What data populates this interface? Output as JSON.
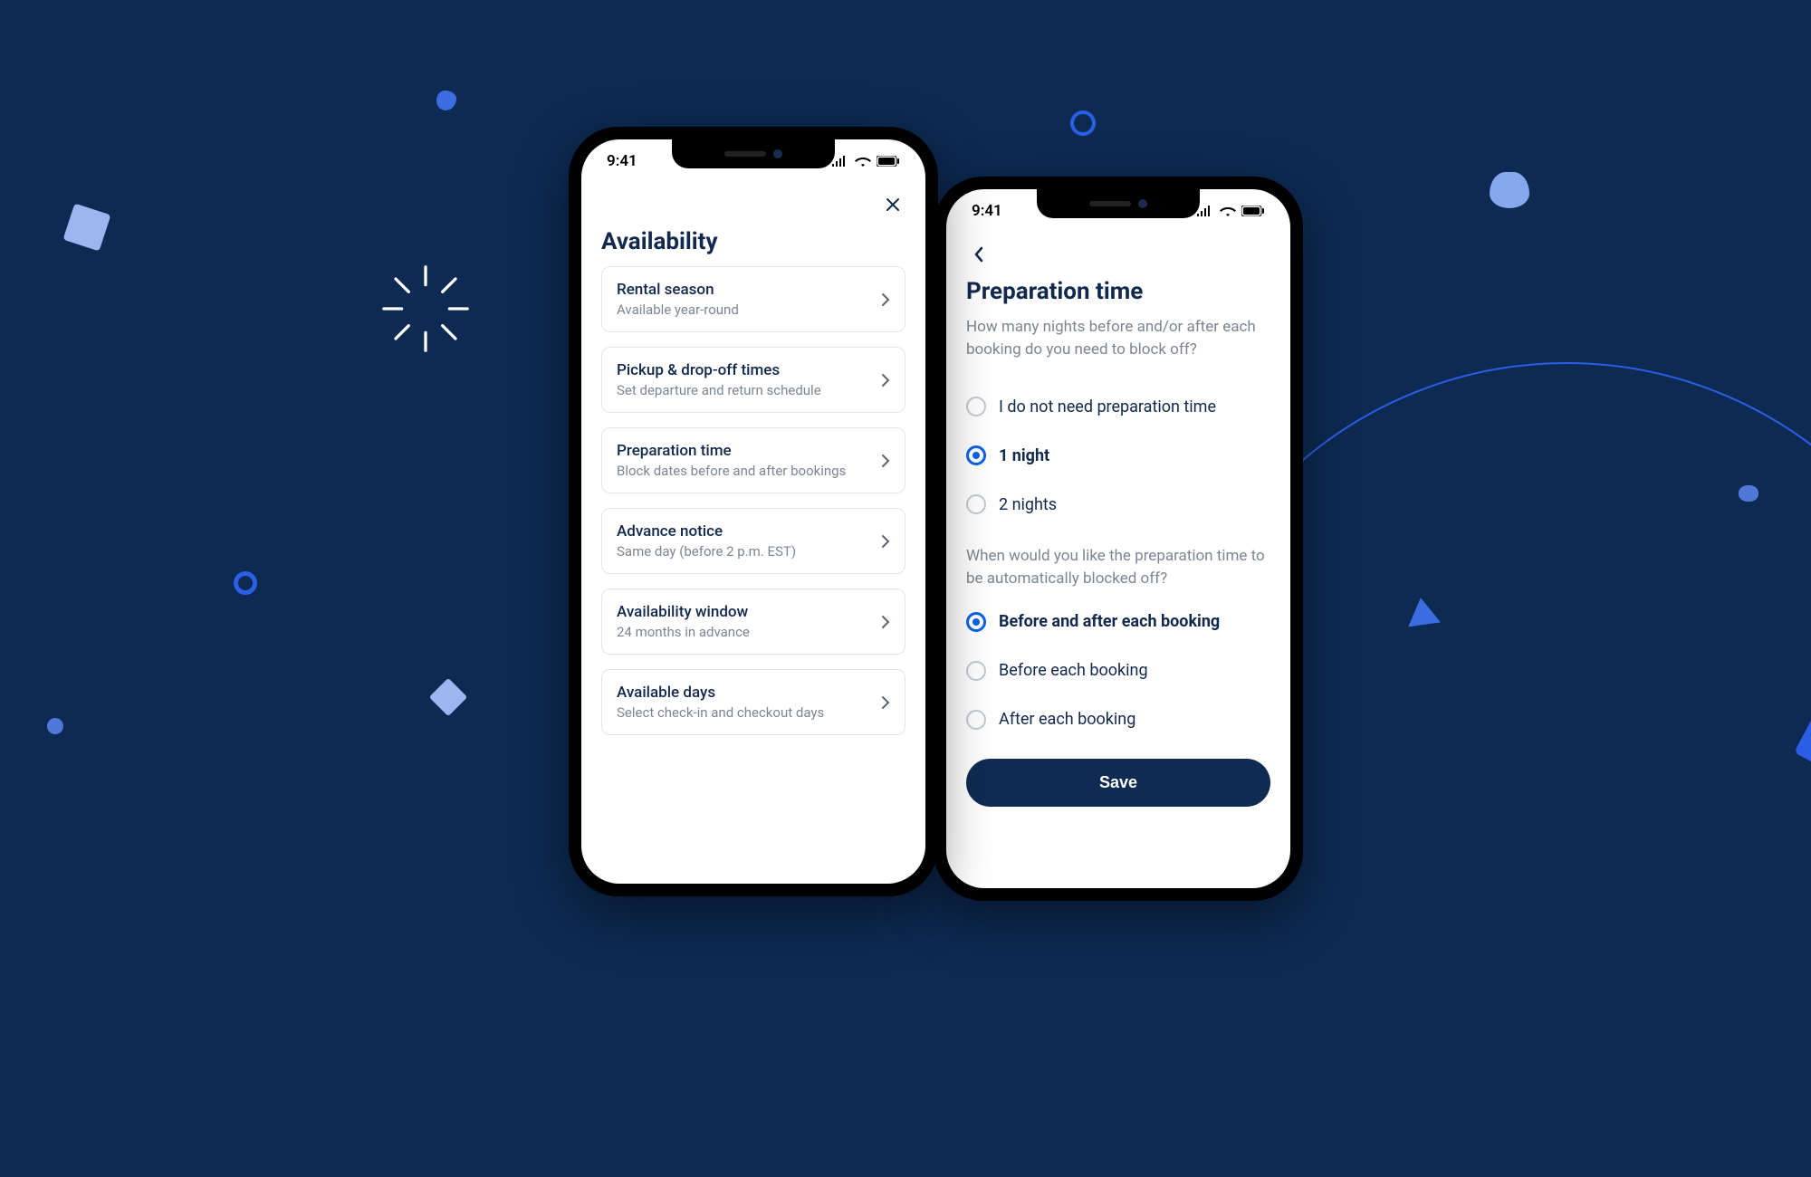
{
  "status_time": "9:41",
  "phone_left": {
    "title": "Availability",
    "items": [
      {
        "title": "Rental season",
        "sub": "Available year-round"
      },
      {
        "title": "Pickup & drop-off times",
        "sub": "Set departure and return schedule"
      },
      {
        "title": "Preparation time",
        "sub": "Block dates before and after bookings"
      },
      {
        "title": "Advance notice",
        "sub": "Same day (before 2 p.m. EST)"
      },
      {
        "title": "Availability window",
        "sub": "24 months in advance"
      },
      {
        "title": "Available days",
        "sub": "Select check-in and checkout days"
      }
    ]
  },
  "phone_right": {
    "title": "Preparation time",
    "subtitle": "How many nights before and/or after each booking do you need to block off?",
    "group1": [
      {
        "label": "I do not need preparation time",
        "selected": false
      },
      {
        "label": "1 night",
        "selected": true
      },
      {
        "label": "2 nights",
        "selected": false
      }
    ],
    "question2": "When would you like the preparation time to be automatically blocked off?",
    "group2": [
      {
        "label": "Before and after each booking",
        "selected": true
      },
      {
        "label": "Before each booking",
        "selected": false
      },
      {
        "label": "After each booking",
        "selected": false
      }
    ],
    "save": "Save"
  }
}
